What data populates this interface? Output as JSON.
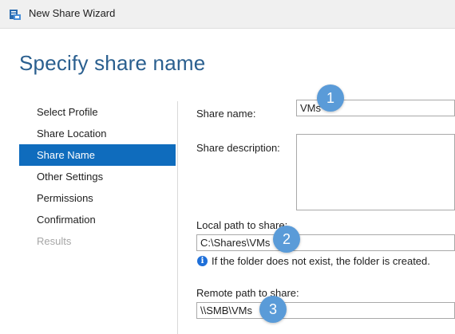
{
  "window": {
    "title": "New Share Wizard"
  },
  "page": {
    "title": "Specify share name"
  },
  "nav": {
    "items": [
      {
        "label": "Select Profile",
        "state": "normal"
      },
      {
        "label": "Share Location",
        "state": "normal"
      },
      {
        "label": "Share Name",
        "state": "active"
      },
      {
        "label": "Other Settings",
        "state": "normal"
      },
      {
        "label": "Permissions",
        "state": "normal"
      },
      {
        "label": "Confirmation",
        "state": "normal"
      },
      {
        "label": "Results",
        "state": "disabled"
      }
    ]
  },
  "form": {
    "share_name_label": "Share name:",
    "share_name_value": "VMs",
    "share_description_label": "Share description:",
    "share_description_value": "",
    "local_path_label": "Local path to share:",
    "local_path_value": "C:\\Shares\\VMs",
    "info_icon": "info-icon",
    "info_text": "If the folder does not exist, the folder is created.",
    "remote_path_label": "Remote path to share:",
    "remote_path_value": "\\\\SMB\\VMs"
  },
  "callouts": [
    "1",
    "2",
    "3"
  ],
  "colors": {
    "accent": "#0f6cbd",
    "title": "#2a5f8f",
    "badge": "#5a9bd8"
  }
}
